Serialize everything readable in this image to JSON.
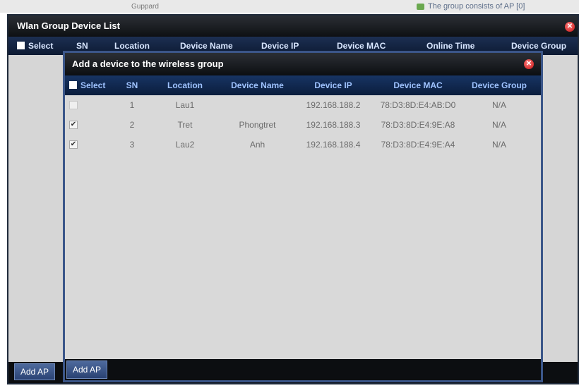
{
  "background": {
    "guard_text": "Guppard",
    "note_text": "The group consists of AP [0]"
  },
  "outer": {
    "title": "Wlan Group Device List",
    "columns": [
      "Select",
      "SN",
      "Location",
      "Device Name",
      "Device IP",
      "Device MAC",
      "Online Time",
      "Device Group"
    ],
    "add_button": "Add AP"
  },
  "dialog": {
    "title": "Add a device to the wireless group",
    "columns": [
      "Select",
      "SN",
      "Location",
      "Device Name",
      "Device IP",
      "Device MAC",
      "Device Group"
    ],
    "rows": [
      {
        "checked": false,
        "disabled": true,
        "sn": "1",
        "location": "Lau1",
        "device_name": "",
        "ip": "192.168.188.2",
        "mac": "78:D3:8D:E4:AB:D0",
        "group": "N/A"
      },
      {
        "checked": true,
        "disabled": false,
        "sn": "2",
        "location": "Tret",
        "device_name": "Phongtret",
        "ip": "192.168.188.3",
        "mac": "78:D3:8D:E4:9E:A8",
        "group": "N/A"
      },
      {
        "checked": true,
        "disabled": false,
        "sn": "3",
        "location": "Lau2",
        "device_name": "Anh",
        "ip": "192.168.188.4",
        "mac": "78:D3:8D:E4:9E:A4",
        "group": "N/A"
      }
    ],
    "add_button": "Add AP"
  },
  "icons": {
    "close": "close-icon",
    "checkbox": "checkbox-icon"
  },
  "colors": {
    "title_bar": "#0e1013",
    "header_bar": "#173463",
    "dialog_border": "#3b5689",
    "close": "#c41212"
  }
}
